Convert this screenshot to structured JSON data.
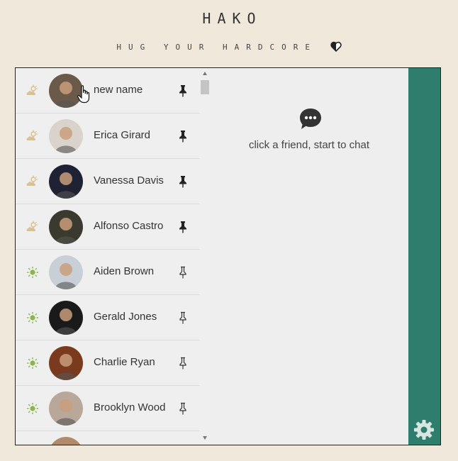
{
  "brand": {
    "title": "HAKO",
    "tagline": "HUG YOUR HARDCORE"
  },
  "friends": [
    {
      "name": "new name",
      "weather": "cloud-sun-icon",
      "pinned": true,
      "avatar_color": "#6b5a4a"
    },
    {
      "name": "Erica Girard",
      "weather": "cloud-sun-icon",
      "pinned": true,
      "avatar_color": "#d9d3cb"
    },
    {
      "name": "Vanessa Davis",
      "weather": "cloud-sun-icon",
      "pinned": true,
      "avatar_color": "#1f2233"
    },
    {
      "name": "Alfonso Castro",
      "weather": "cloud-sun-icon",
      "pinned": true,
      "avatar_color": "#3b3a2e"
    },
    {
      "name": "Aiden Brown",
      "weather": "sun-icon",
      "pinned": false,
      "avatar_color": "#c9cfd6"
    },
    {
      "name": "Gerald Jones",
      "weather": "sun-icon",
      "pinned": false,
      "avatar_color": "#1a1a1a"
    },
    {
      "name": "Charlie Ryan",
      "weather": "sun-icon",
      "pinned": false,
      "avatar_color": "#7a3a1e"
    },
    {
      "name": "Brooklyn Wood",
      "weather": "sun-icon",
      "pinned": false,
      "avatar_color": "#b9a79a"
    },
    {
      "name": "",
      "weather": "",
      "pinned": false,
      "avatar_color": "#b08a6a"
    }
  ],
  "chat": {
    "hint": "click a friend, start to chat"
  },
  "colors": {
    "accent": "#2f7d6d",
    "background": "#f1e8dc",
    "cloud": "#d6c28a",
    "sun": "#8db34a"
  }
}
